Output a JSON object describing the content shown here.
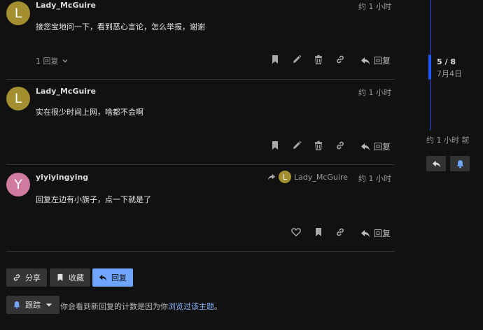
{
  "posts": [
    {
      "avatar_letter": "L",
      "avatar_color": "#a38f2f",
      "username": "Lady_McGuire",
      "time": "约 1 小时",
      "content": "接您宝地问一下，看到恶心言论，怎么举报，谢谢",
      "replies": "1 回复",
      "reply_label": "回复"
    },
    {
      "avatar_letter": "L",
      "avatar_color": "#a38f2f",
      "username": "Lady_McGuire",
      "time": "约 1 小时",
      "content": "实在很少时间上网，啥都不会啊",
      "reply_label": "回复"
    },
    {
      "avatar_letter": "Y",
      "avatar_color": "#d07aa0",
      "username": "yiyiyingying",
      "time": "约 1 小时",
      "reply_to_letter": "L",
      "reply_to_name": "Lady_McGuire",
      "content": "回复左边有小旗子，点一下就是了",
      "reply_label": "回复"
    }
  ],
  "footer": {
    "share_label": "分享",
    "bookmark_label": "收藏",
    "reply_label": "回复",
    "track_label": "跟踪",
    "notice_prefix": "你会看到新回复的计数是因为你",
    "notice_link": "浏览过该主题",
    "notice_suffix": "。"
  },
  "timeline": {
    "position": "5 / 8",
    "date": "7月4日",
    "last_activity": "约 1 小时 前"
  },
  "colors": {
    "accent": "#6fa4ff",
    "timeline": "#2058ff",
    "background": "#111111"
  }
}
